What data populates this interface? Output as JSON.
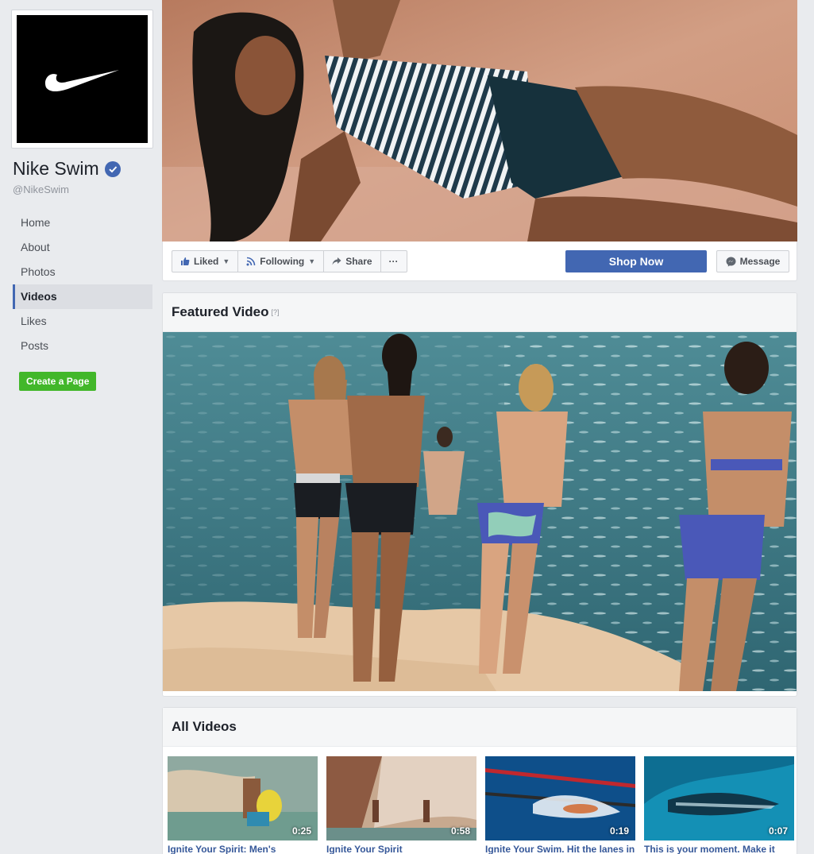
{
  "page": {
    "name": "Nike Swim",
    "handle": "@NikeSwim"
  },
  "nav": [
    "Home",
    "About",
    "Photos",
    "Videos",
    "Likes",
    "Posts"
  ],
  "active_nav": "Videos",
  "create_page_label": "Create a Page",
  "actions": {
    "liked": "Liked",
    "following": "Following",
    "share": "Share",
    "more": "···",
    "shop_now": "Shop Now",
    "message": "Message"
  },
  "featured": {
    "title": "Featured Video",
    "help": "[?]"
  },
  "all_videos": {
    "title": "All Videos",
    "items": [
      {
        "title": "Ignite Your Spirit: Men's",
        "duration": "0:25"
      },
      {
        "title": "Ignite Your Spirit",
        "duration": "0:58"
      },
      {
        "title": "Ignite Your Swim. Hit the lanes in",
        "duration": "0:19"
      },
      {
        "title": "This is your moment. Make it",
        "duration": "0:07"
      }
    ]
  },
  "colors": {
    "background": "#e9ebee",
    "facebook_blue": "#4267b2",
    "create_green": "#42b72a",
    "link": "#365899"
  }
}
